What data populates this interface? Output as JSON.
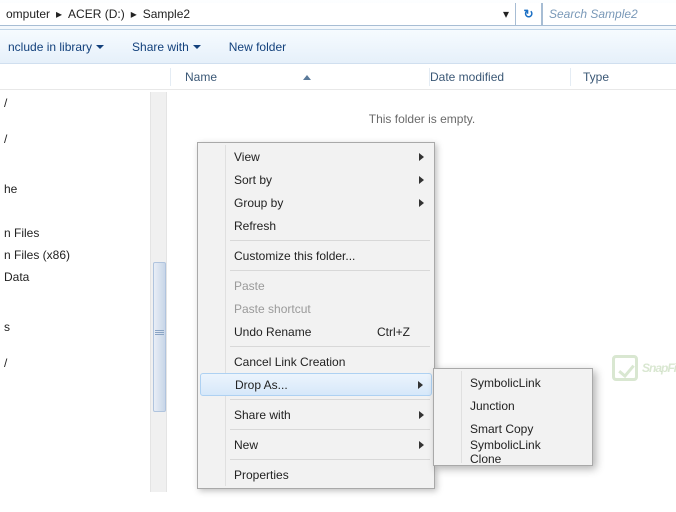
{
  "breadcrumb": {
    "parts": [
      "omputer",
      "ACER (D:)",
      "Sample2"
    ]
  },
  "refresh_icon": "↻",
  "search": {
    "placeholder": "Search Sample2"
  },
  "toolbar": {
    "include": "nclude in library",
    "share": "Share with",
    "newfolder": "New folder"
  },
  "columns": {
    "name": "Name",
    "date": "Date modified",
    "type": "Type"
  },
  "tree": {
    "items": [
      "/",
      "/",
      "he",
      "",
      "n Files",
      "n Files (x86)",
      "Data",
      "",
      "",
      "s",
      "/"
    ]
  },
  "main": {
    "empty": "This folder is empty."
  },
  "context": {
    "view": "View",
    "sortby": "Sort by",
    "groupby": "Group by",
    "refresh": "Refresh",
    "customize": "Customize this folder...",
    "paste": "Paste",
    "paste_shortcut": "Paste shortcut",
    "undo": "Undo Rename",
    "undo_key": "Ctrl+Z",
    "cancel_link": "Cancel Link Creation",
    "drop_as": "Drop As...",
    "share_with": "Share with",
    "new": "New",
    "properties": "Properties"
  },
  "submenu": {
    "symboliclink": "SymbolicLink",
    "junction": "Junction",
    "smartcopy": "Smart Copy",
    "symboliclink_clone": "SymbolicLink Clone"
  },
  "watermark": "SnapFi"
}
